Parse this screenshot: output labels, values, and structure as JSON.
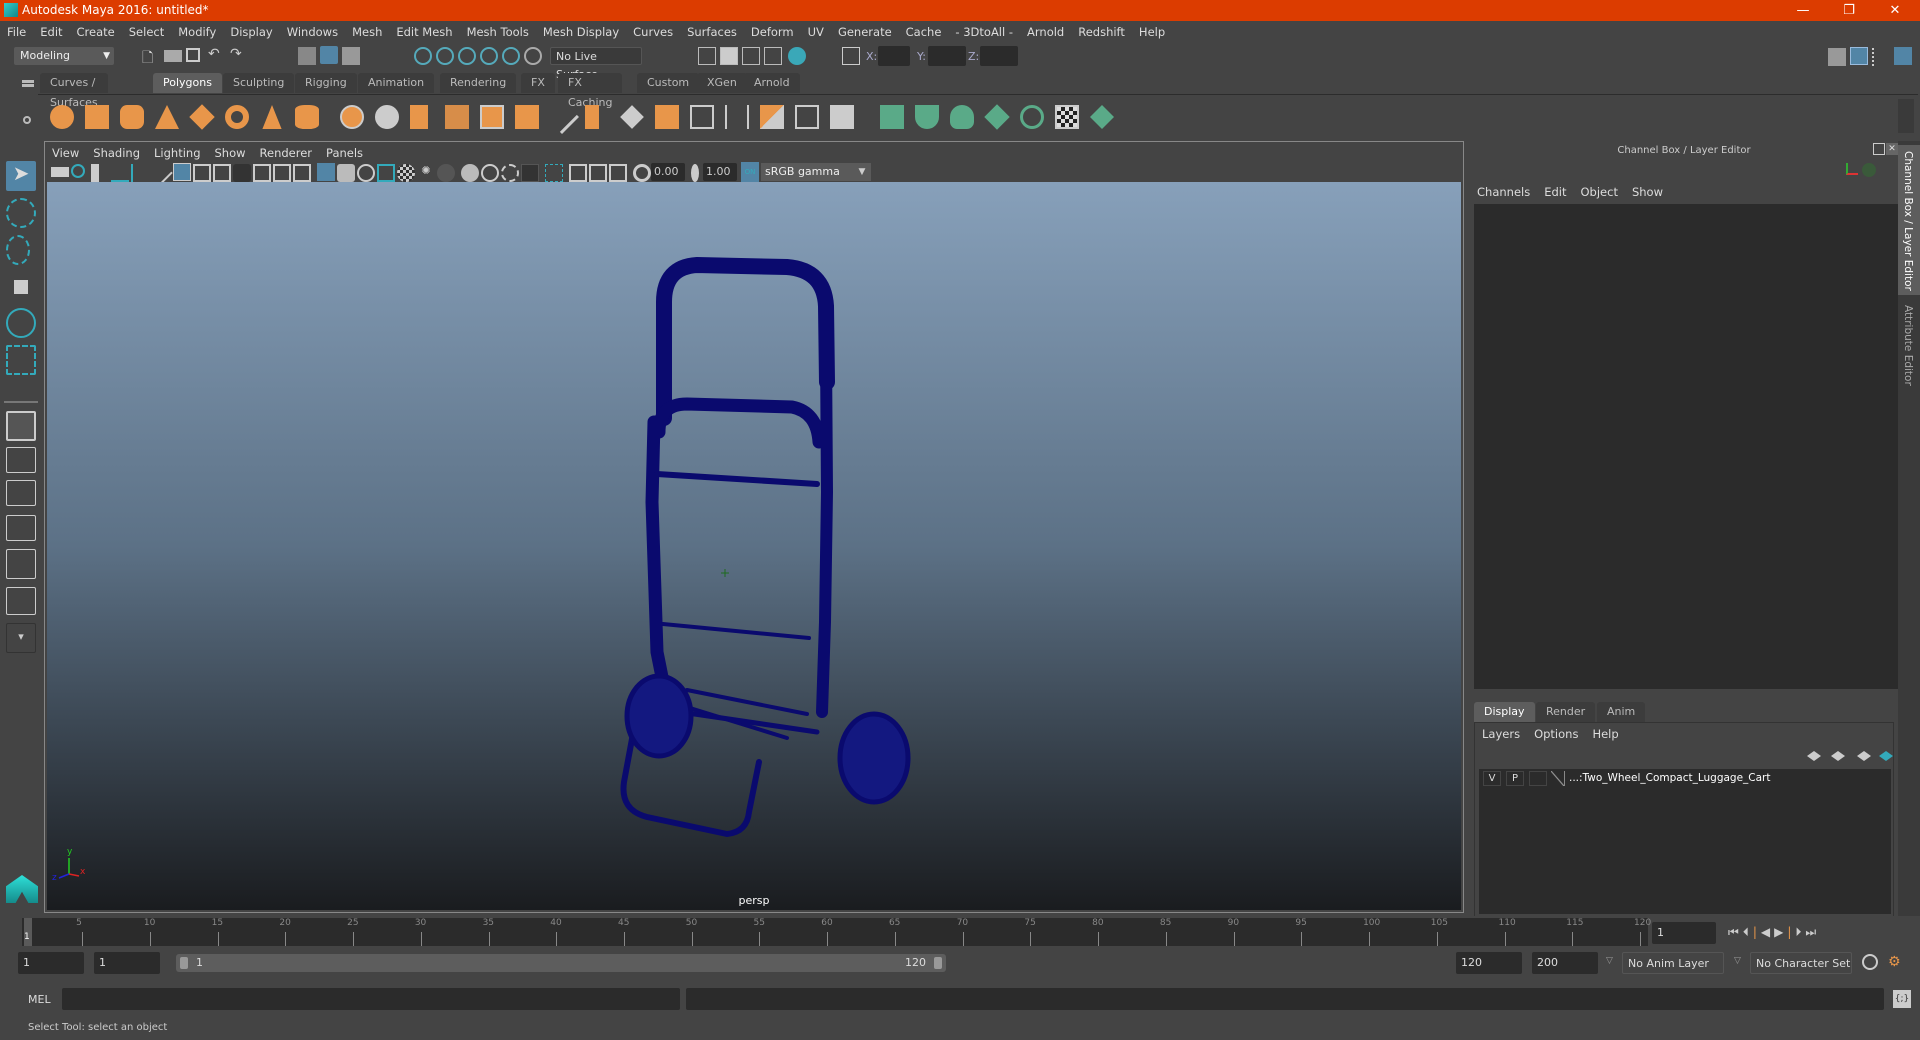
{
  "window": {
    "title": "Autodesk Maya 2016: untitled*",
    "minimize": "—",
    "restore": "❐",
    "close": "✕"
  },
  "menubar": [
    "File",
    "Edit",
    "Create",
    "Select",
    "Modify",
    "Display",
    "Windows",
    "Mesh",
    "Edit Mesh",
    "Mesh Tools",
    "Mesh Display",
    "Curves",
    "Surfaces",
    "Deform",
    "UV",
    "Generate",
    "Cache",
    "- 3DtoAll -",
    "Arnold",
    "Redshift",
    "Help"
  ],
  "status_line": {
    "menu_set": "Modeling",
    "live_surface": "No Live Surface",
    "x_label": "X:",
    "y_label": "Y:",
    "z_label": "Z:",
    "x": "",
    "y": "",
    "z": ""
  },
  "shelf_tabs": [
    "Curves / Surfaces",
    "Polygons",
    "Sculpting",
    "Rigging",
    "Animation",
    "Rendering",
    "FX",
    "FX Caching",
    "Custom",
    "XGen",
    "Arnold"
  ],
  "active_shelf_tab": "Polygons",
  "viewport": {
    "menus": [
      "View",
      "Shading",
      "Lighting",
      "Show",
      "Renderer",
      "Panels"
    ],
    "exposure": "0.00",
    "gamma": "1.00",
    "color_mgmt_on": "ON",
    "color_space": "sRGB gamma",
    "camera": "persp",
    "axis": {
      "x": "x",
      "y": "y",
      "z": "z"
    }
  },
  "channel_box": {
    "title": "Channel Box / Layer Editor",
    "menus": [
      "Channels",
      "Edit",
      "Object",
      "Show"
    ]
  },
  "layer_editor": {
    "tabs": [
      "Display",
      "Render",
      "Anim"
    ],
    "active_tab": "Display",
    "menus": [
      "Layers",
      "Options",
      "Help"
    ],
    "layers": [
      {
        "v": "V",
        "p": "P",
        "name": "...:Two_Wheel_Compact_Luggage_Cart"
      }
    ]
  },
  "side_tabs": [
    "Channel Box / Layer Editor",
    "Attribute Editor"
  ],
  "timeline": {
    "ticks": [
      "5",
      "10",
      "15",
      "20",
      "25",
      "30",
      "35",
      "40",
      "45",
      "50",
      "55",
      "60",
      "65",
      "70",
      "75",
      "80",
      "85",
      "90",
      "95",
      "100",
      "105",
      "110",
      "115",
      "120"
    ],
    "current_frame_marker": "1",
    "current_frame": "1"
  },
  "range": {
    "start": "1",
    "playback_start": "1",
    "slider_start": "1",
    "slider_end": "120",
    "playback_end": "120",
    "end": "200",
    "anim_layer": "No Anim Layer",
    "character_set": "No Character Set"
  },
  "command_line": {
    "label": "MEL",
    "input": "",
    "output": ""
  },
  "help_line": "Select Tool: select an object",
  "colors": {
    "title_bar": "#dc3c00",
    "accent_blue": "#5285a6",
    "wire": "#0a0a6e",
    "shelf_orange": "#e8964a",
    "shelf_green": "#5aaa88"
  }
}
